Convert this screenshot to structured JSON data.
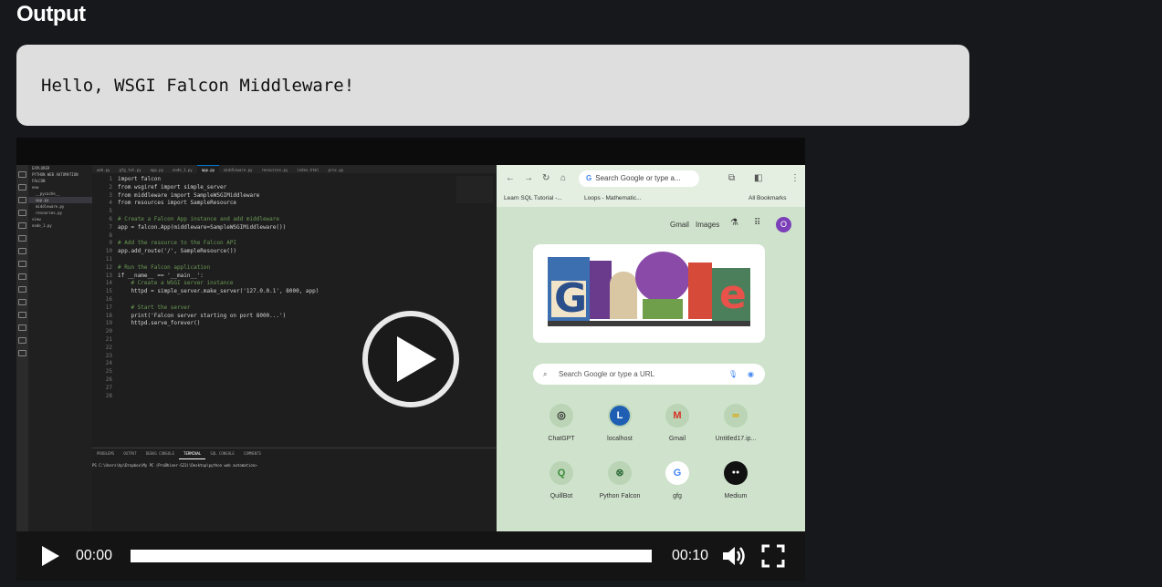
{
  "section": {
    "heading": "Output"
  },
  "output": {
    "text": "Hello, WSGI Falcon Middleware!"
  },
  "video": {
    "current_time": "00:00",
    "duration": "00:10",
    "progress": 0.0,
    "state": "paused",
    "icons": [
      "play-icon",
      "volume-icon",
      "fullscreen-icon",
      "big-play-icon"
    ]
  },
  "thumbnail": {
    "vscode": {
      "explorer": [
        "EXPLORER",
        "PYTHON WEB AUTOMATION",
        "FALCON",
        "new",
        "__pycache__",
        "app.py",
        "middleware.py",
        "resources.py",
        "view",
        "node_1.py"
      ],
      "tabs": [
        "web.py",
        "gfg_tut.py",
        "app.py",
        "node_1.py",
        "app.py",
        "middleware.py",
        "resources.py",
        "index.html",
        "proc.py"
      ],
      "code_lines": [
        "import falcon",
        "from wsgiref import simple_server",
        "from middleware import SampleWSGIMiddleware",
        "from resources import SampleResource",
        "",
        "# Create a Falcon App instance and add middleware",
        "app = falcon.App(middleware=SampleWSGIMiddleware())",
        "",
        "# Add the resource to the Falcon API",
        "app.add_route('/', SampleResource())",
        "",
        "# Run the Falcon application",
        "if __name__ == '__main__':",
        "    # Create a WSGI server instance",
        "    httpd = simple_server.make_server('127.0.0.1', 8000, app)",
        "",
        "    # Start the server",
        "    print('Falcon server starting on port 8000...')",
        "    httpd.serve_forever()"
      ],
      "line_count": 28,
      "panel_tabs": [
        "PROBLEMS",
        "OUTPUT",
        "DEBUG CONSOLE",
        "TERMINAL",
        "SQL CONSOLE",
        "COMMENTS"
      ],
      "terminal_prompt": "PS C:\\Users\\hp\\Dropbox\\My PC (ProBhiner-G23)\\Desktop\\python web automation> "
    },
    "chrome": {
      "omnibox": "Search Google or type a...",
      "bookmarks": [
        "Learn SQL Tutorial -...",
        "Loops - Mathematic...",
        "All Bookmarks"
      ],
      "top_links": [
        "Gmail",
        "Images"
      ],
      "avatar_letter": "O",
      "search_placeholder": "Search Google or type a URL",
      "shortcuts": [
        {
          "label": "ChatGPT",
          "glyph": "◎"
        },
        {
          "label": "localhost",
          "glyph": "L"
        },
        {
          "label": "Gmail",
          "glyph": "M"
        },
        {
          "label": "Untitled17.ip...",
          "glyph": "∞"
        },
        {
          "label": "QuillBot",
          "glyph": "Q"
        },
        {
          "label": "Python Falcon",
          "glyph": "⊗"
        },
        {
          "label": "gfg",
          "glyph": "G"
        },
        {
          "label": "Medium",
          "glyph": "●●"
        }
      ]
    }
  },
  "colors": {
    "page_bg": "#17181c",
    "output_bg": "#dedede",
    "video_bg": "#0c0c0c",
    "chrome_bg": "#cfe3cc",
    "avatar": "#7b3fb8"
  }
}
